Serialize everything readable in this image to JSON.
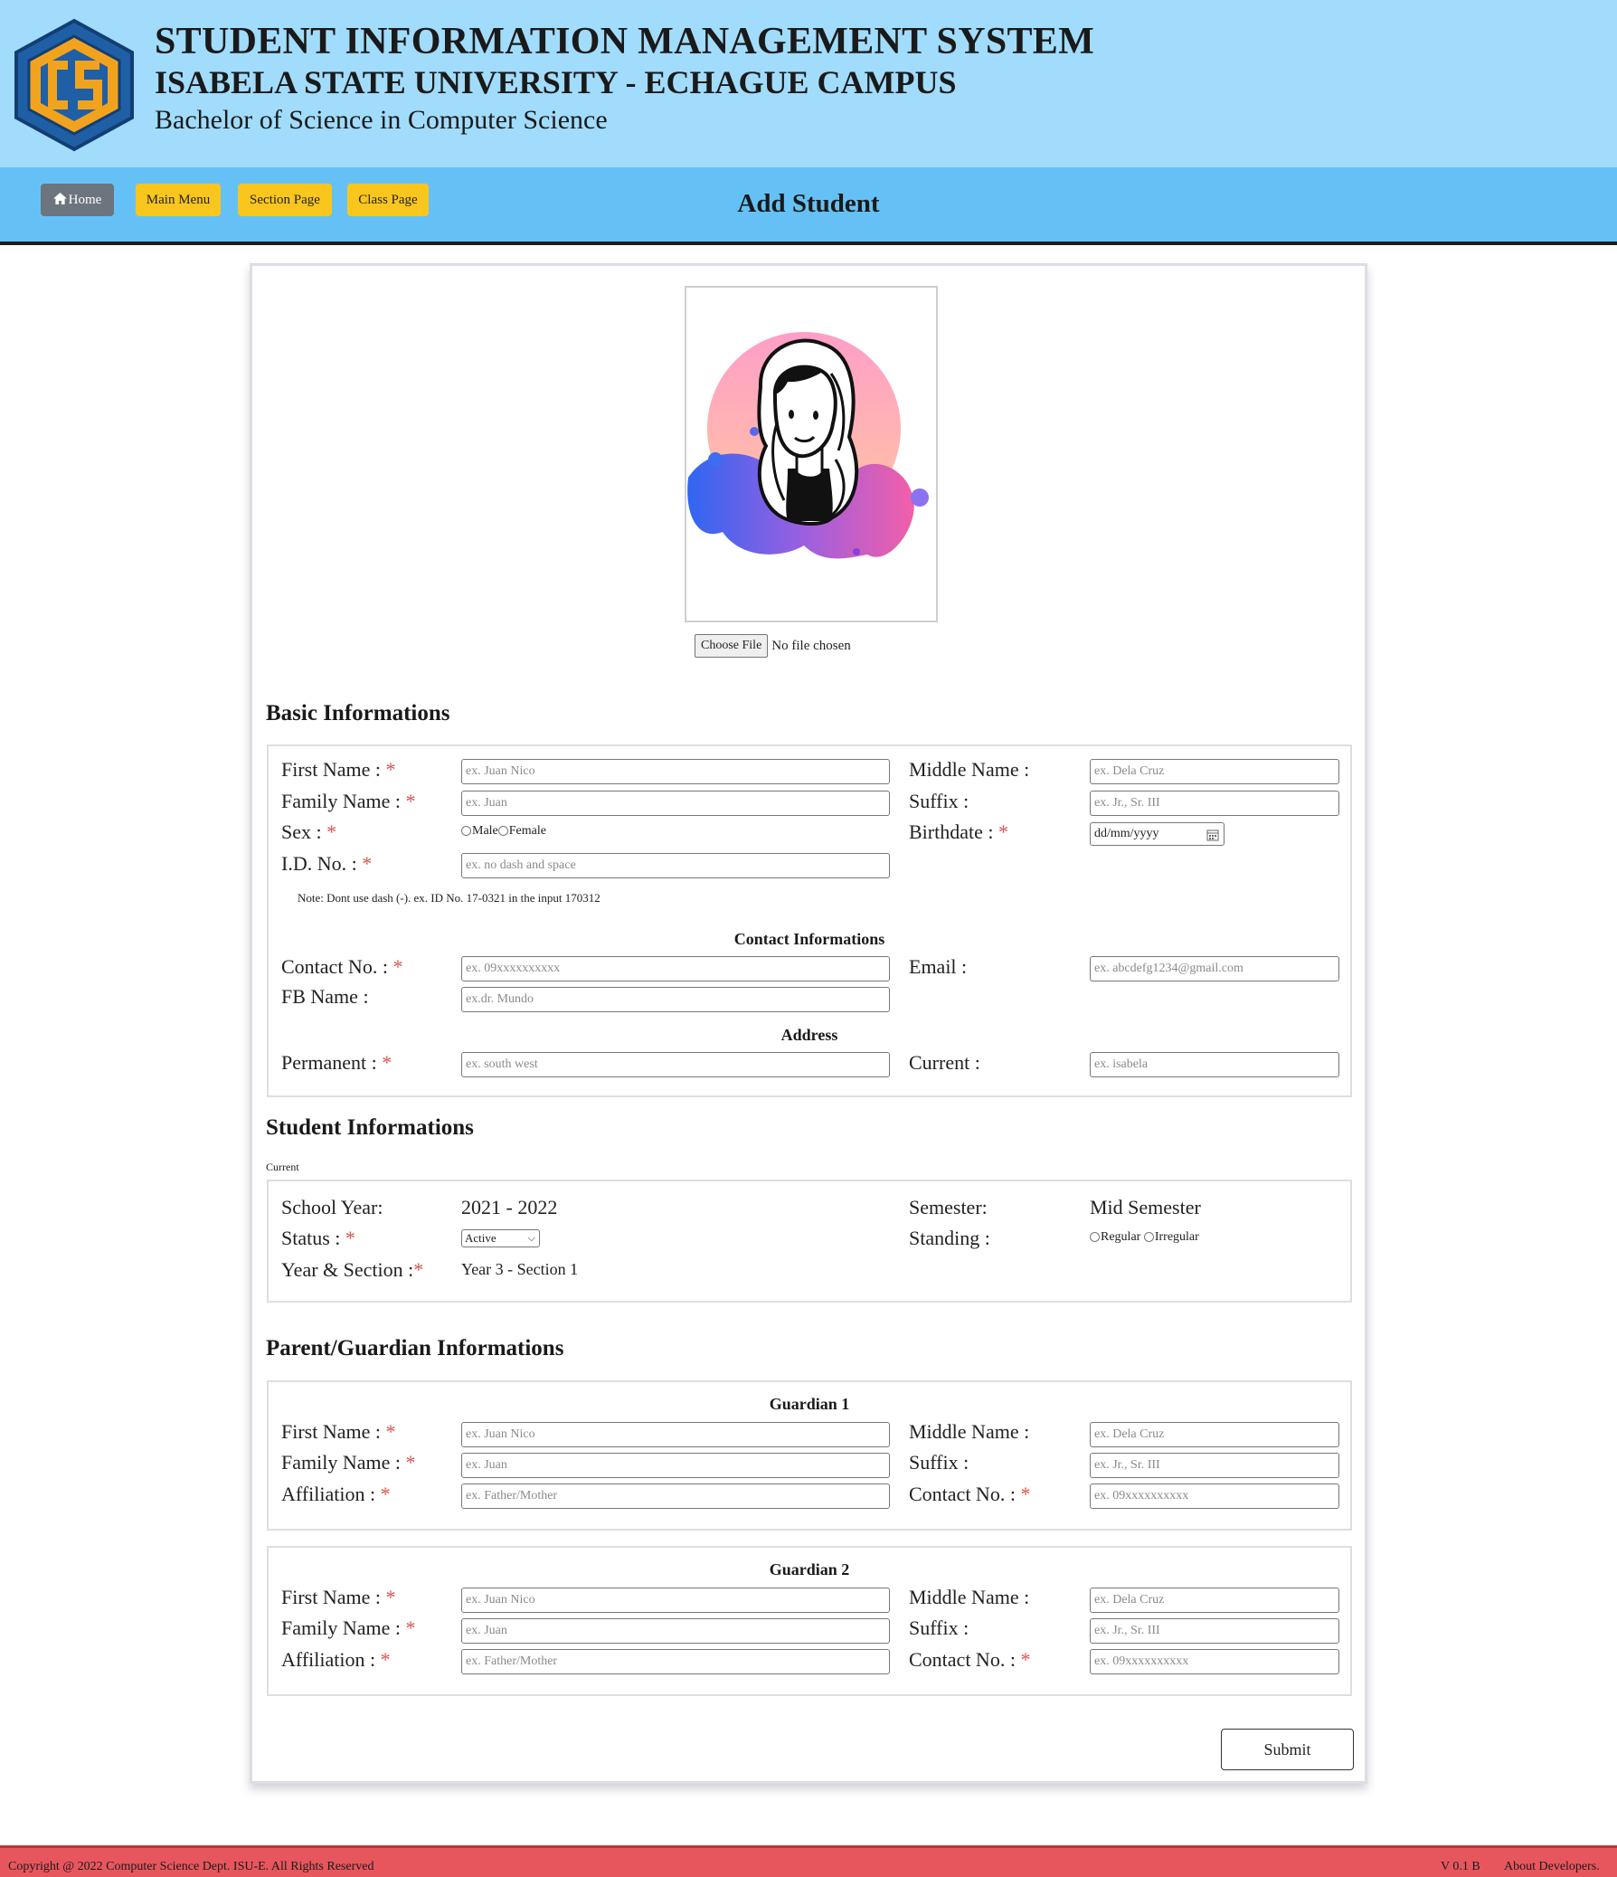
{
  "header": {
    "title": "STUDENT INFORMATION MANAGEMENT SYSTEM",
    "university": "ISABELA STATE UNIVERSITY - ECHAGUE CAMPUS",
    "program": "Bachelor of Science in Computer Science"
  },
  "nav": {
    "home": "Home",
    "main_menu": "Main Menu",
    "section_page": "Section Page",
    "class_page": "Class Page",
    "page_title": "Add Student"
  },
  "photo": {
    "choose_file": "Choose File",
    "no_file": "No file chosen"
  },
  "basic": {
    "title": "Basic Informations",
    "first_name_label": "First Name :",
    "first_name_ph": "ex. Juan Nico",
    "middle_name_label": "Middle Name :",
    "middle_name_ph": "ex. Dela Cruz",
    "family_name_label": "Family Name :",
    "family_name_ph": "ex. Juan",
    "suffix_label": "Suffix :",
    "suffix_ph": "ex. Jr., Sr. III",
    "sex_label": "Sex :",
    "sex_male": "Male",
    "sex_female": "Female",
    "birthdate_label": "Birthdate :",
    "birthdate_ph": "dd/mm/yyyy",
    "id_label": "I.D. No. :",
    "id_ph": "ex. no dash and space",
    "note": "Note: Dont use dash (-). ex. ID No. 17-0321 in the input 170312",
    "contact_heading": "Contact Informations",
    "contact_label": "Contact No. :",
    "contact_ph": "ex. 09xxxxxxxxxx",
    "email_label": "Email :",
    "email_ph": "ex. abcdefg1234@gmail.com",
    "fb_label": "FB Name :",
    "fb_ph": "ex.dr. Mundo",
    "address_heading": "Address",
    "permanent_label": "Permanent :",
    "permanent_ph": "ex. south west",
    "current_label": "Current :",
    "current_ph": "ex. isabela"
  },
  "student": {
    "title": "Student Informations",
    "current_tag": "Current",
    "school_year_label": "School Year:",
    "school_year": "2021 - 2022",
    "semester_label": "Semester:",
    "semester": "Mid Semester",
    "status_label": "Status :",
    "status_value": "Active",
    "standing_label": "Standing :",
    "standing_regular": "Regular",
    "standing_irregular": "Irregular",
    "year_section_label": "Year & Section :",
    "year_section": "Year 3 - Section 1"
  },
  "parent": {
    "title": "Parent/Guardian Informations",
    "guardian1": "Guardian 1",
    "guardian2": "Guardian 2",
    "first_name_label": "First Name :",
    "first_name_ph": "ex. Juan Nico",
    "middle_name_label": "Middle Name :",
    "middle_name_ph": "ex. Dela Cruz",
    "family_name_label": "Family Name :",
    "family_name_ph": "ex. Juan",
    "suffix_label": "Suffix :",
    "suffix_ph": "ex. Jr., Sr. III",
    "affiliation_label": "Affiliation :",
    "affiliation_ph": "ex. Father/Mother",
    "contact_label": "Contact No. :",
    "contact_ph": "ex. 09xxxxxxxxxx"
  },
  "form": {
    "submit": "Submit",
    "required_mark": "*"
  },
  "footer": {
    "copyright": "Copyright @ 2022 Computer Science Dept. ISU-E. All Rights Reserved",
    "version": "V 0.1 B",
    "about": "About Developers."
  },
  "colors": {
    "header_bg": "#a1dcfc",
    "nav_bg": "#65c1f5",
    "nav_button": "#f9c61d",
    "home_button": "#6c757d",
    "required": "#d9534f",
    "footer_bg": "#e8565d"
  },
  "icons": [
    "logo-cs-hexagon",
    "home-icon",
    "calendar-icon",
    "avatar-illustration"
  ]
}
